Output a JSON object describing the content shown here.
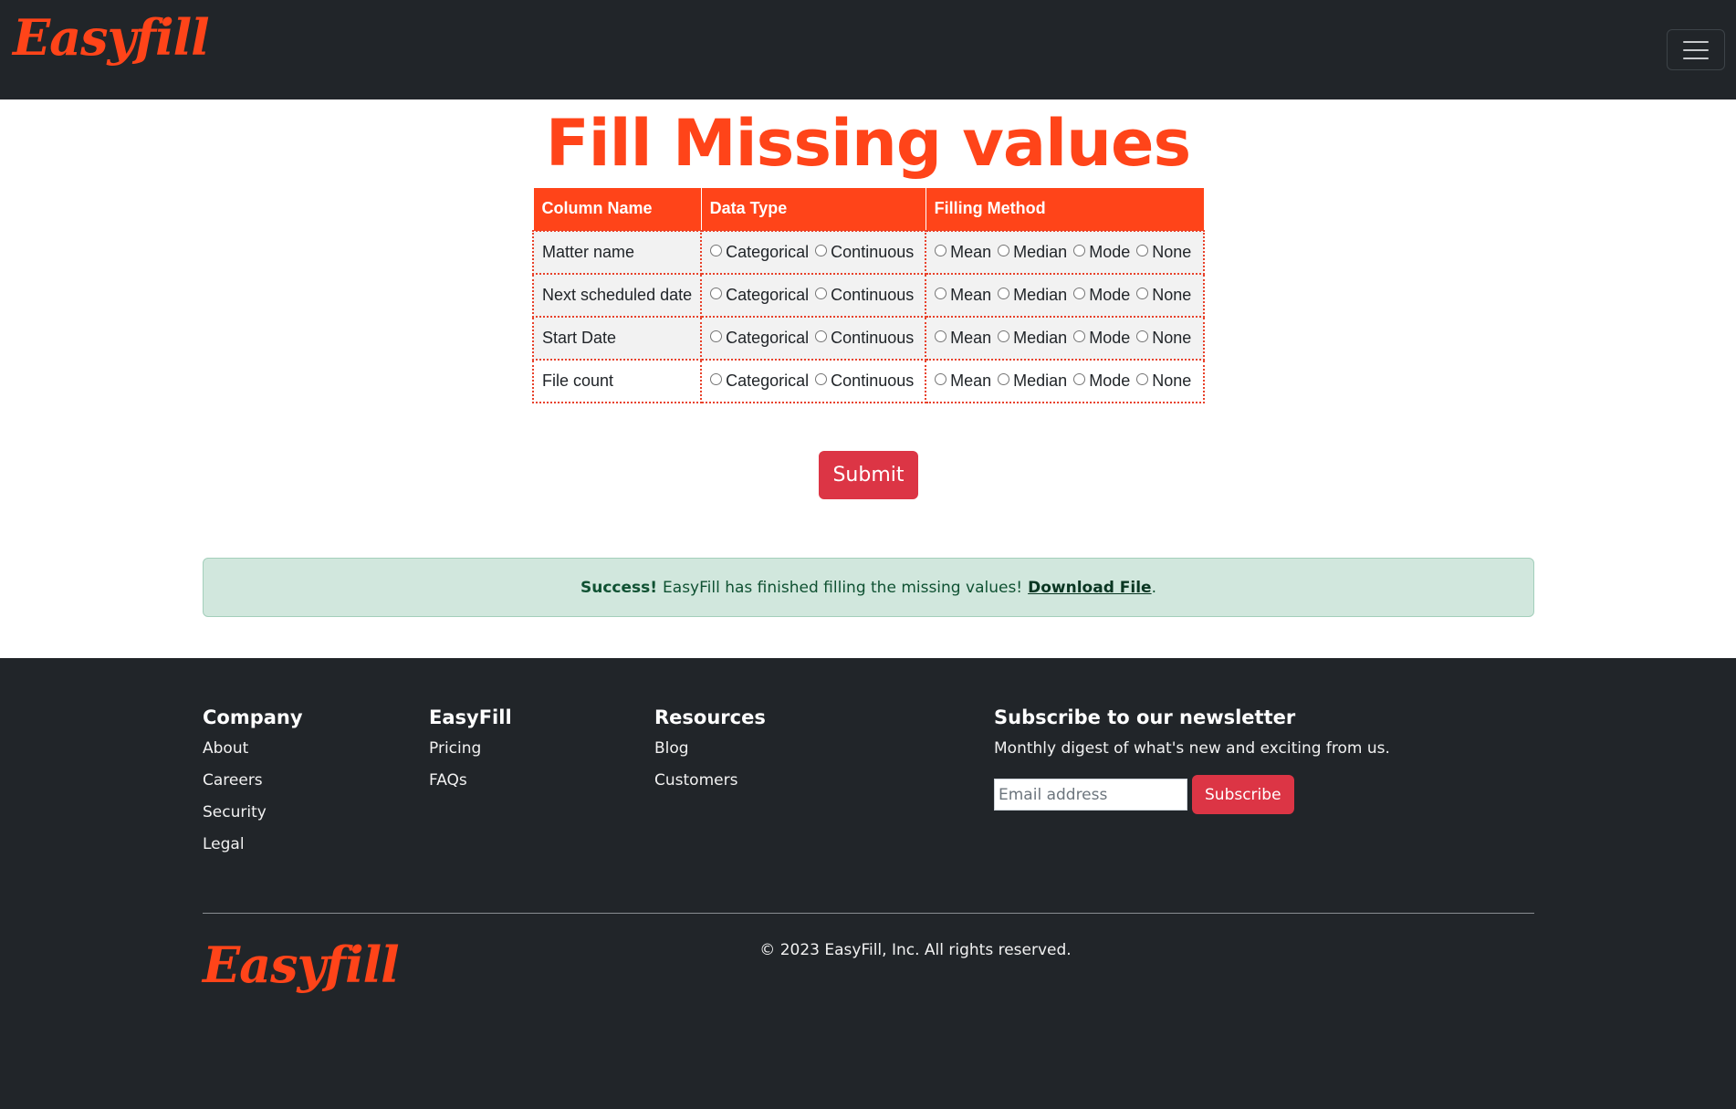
{
  "navbar": {
    "brand": "Easyfill",
    "toggle_icon": "hamburger-icon"
  },
  "main": {
    "title": "Fill Missing values",
    "table": {
      "headers": [
        "Column Name",
        "Data Type",
        "Filling Method"
      ],
      "data_type_options": [
        "Categorical",
        "Continuous"
      ],
      "filling_options": [
        "Mean",
        "Median",
        "Mode",
        "None"
      ],
      "rows": [
        "Matter name",
        "Next scheduled date",
        "Start Date",
        "File count"
      ]
    },
    "submit_label": "Submit",
    "alert": {
      "strong": "Success!",
      "message": "EasyFill has finished filling the missing values!",
      "link": "Download File",
      "suffix": "."
    }
  },
  "footer": {
    "company": {
      "heading": "Company",
      "links": [
        "About",
        "Careers",
        "Security",
        "Legal"
      ]
    },
    "easyfill": {
      "heading": "EasyFill",
      "links": [
        "Pricing",
        "FAQs"
      ]
    },
    "resources": {
      "heading": "Resources",
      "links": [
        "Blog",
        "Customers"
      ]
    },
    "newsletter": {
      "heading": "Subscribe to our newsletter",
      "text": "Monthly digest of what's new and exciting from us.",
      "placeholder": "Email address",
      "button": "Subscribe"
    },
    "brand": "Easyfill",
    "copyright": "© 2023 EasyFill, Inc. All rights reserved."
  },
  "colors": {
    "accent": "#ff4419",
    "dark": "#212529",
    "danger": "#dc3545",
    "success_bg": "#d1e7dd"
  }
}
